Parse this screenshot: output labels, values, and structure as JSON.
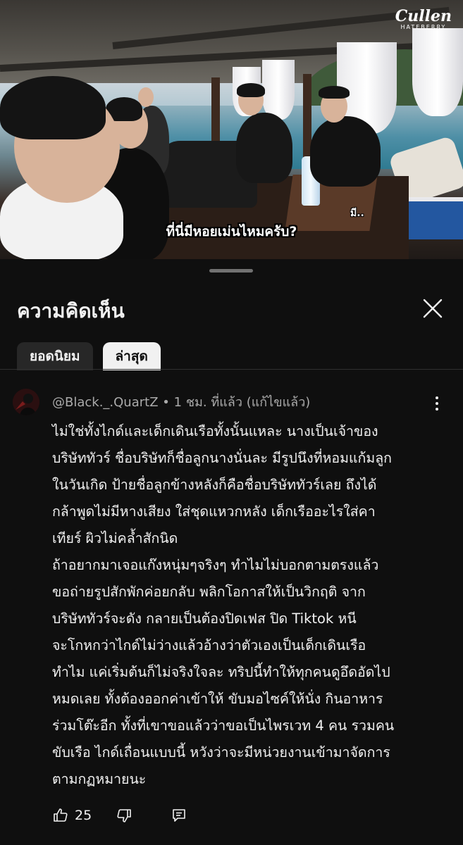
{
  "video": {
    "brand_name": "Cullen",
    "brand_sub": "HATEBERRY",
    "subtitle_main": "ที่นี่มีหอยเม่นไหมครับ?",
    "subtitle_side": "มี.."
  },
  "sheet": {
    "title": "ความคิดเห็น",
    "close_icon": "close-icon",
    "tabs": [
      {
        "label": "ยอดนิยม",
        "active": false
      },
      {
        "label": "ล่าสุด",
        "active": true
      }
    ]
  },
  "comment": {
    "author": "@Black._.QuartZ",
    "separator": "•",
    "time": "1 ชม. ที่แล้ว",
    "edited": "(แก้ไขแล้ว)",
    "lines": [
      "ไม่ใช่ทั้งไกด์และเด็กเดินเรือทั้งนั้นแหละ นางเป็นเจ้าของ",
      "บริษัททัวร์ ชื่อบริษัทก็ชื่อลูกนางนั่นละ มีรูปนึงที่หอมแก้มลูก",
      "ในวันเกิด ป้ายชื่อลูกข้างหลังก็คือชื่อบริษัททัวร์เลย ถึงได้",
      "กล้าพูดไม่มีหางเสียง ใส่ชุดแหวกหลัง เด็กเรืออะไรใส่คา",
      "เทียร์ ผิวไม่คล้ำสักนิด",
      "ถ้าอยากมาเจอแก๊งหนุ่มๆจริงๆ ทำไมไม่บอกตามตรงแล้ว",
      "ขอถ่ายรูปสักพักค่อยกลับ พลิกโอกาสให้เป็นวิกฤติ จาก",
      "บริษัททัวร์จะดัง กลายเป็นต้องปิดเฟส ปิด Tiktok หนี",
      "จะโกหกว่าไกด์ไม่ว่างแล้วอ้างว่าตัวเองเป็นเด็กเดินเรือ",
      "ทำไม แค่เริ่มต้นก็ไม่จริงใจละ ทริปนี้ทำให้ทุกคนดูอึดอัดไป",
      "หมดเลย ทั้งต้องออกค่าเข้าให้ ขับมอไซค์ให้นั่ง กินอาหาร",
      "ร่วมโต๊ะอีก ทั้งที่เขาขอแล้วว่าขอเป็นไพรเวท 4 คน รวมคน",
      "ขับเรือ ไกด์เถื่อนแบบนี้ หวังว่าจะมีหน่วยงานเข้ามาจัดการ",
      "ตามกฏหมายนะ"
    ],
    "like_count": "25",
    "icons": {
      "like": "thumbs-up-icon",
      "dislike": "thumbs-down-icon",
      "reply": "reply-icon",
      "menu": "more-vert-icon"
    }
  }
}
